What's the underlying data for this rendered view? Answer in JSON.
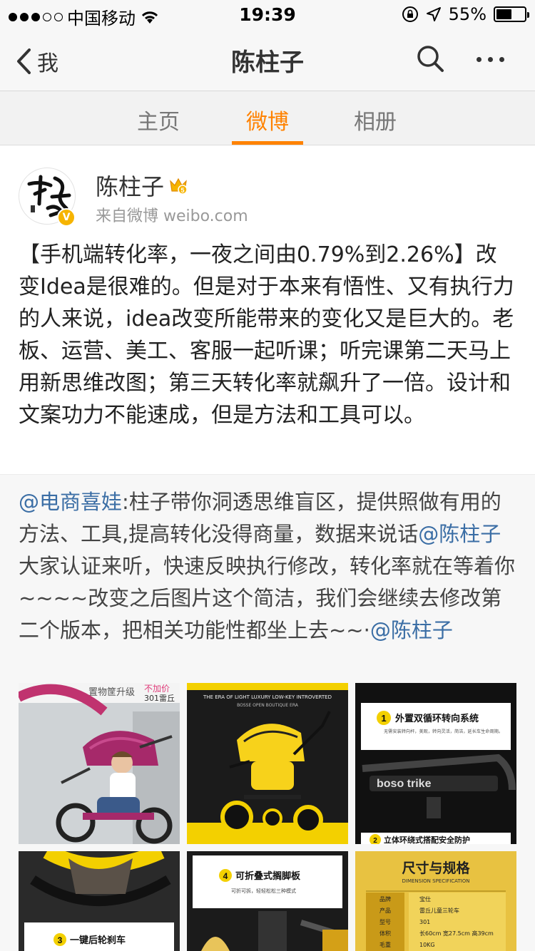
{
  "status_bar": {
    "carrier": "中国移动",
    "time": "19:39",
    "battery": "55%",
    "battery_level": 0.55
  },
  "nav": {
    "back_label": "我",
    "title": "陈柱子"
  },
  "tabs": [
    {
      "label": "主页"
    },
    {
      "label": "微博"
    },
    {
      "label": "相册"
    }
  ],
  "post": {
    "user_name": "陈柱子",
    "source": "来自微博 weibo.com",
    "content": "【手机端转化率，一夜之间由0.79%到2.26%】改变Idea是很难的。但是对于本来有悟性、又有执行力的人来说，idea改变所能带来的变化又是巨大的。老板、运营、美工、客服一起听课；听完课第二天马上用新思维改图；第三天转化率就飙升了一倍。设计和文案功力不能速成，但是方法和工具可以。"
  },
  "retweet": {
    "mention1": "@电商喜娃",
    "text1": ":柱子带你洞透思维盲区，提供照做有用的方法、工具,提高转化没得商量，数据来说话",
    "mention2": "@陈柱子",
    "text2": " 大家认证来听，快速反映执行修改，转化率就在等着你~~~~改变之后图片这个简洁，我们会继续去修改第二个版本，把相关功能性都坐上去~~·",
    "mention3": "@陈柱子"
  },
  "images": {
    "img1": {
      "top_label": "置物筐升级",
      "tag": "不加价",
      "sub": "301雷丘"
    },
    "img2": {
      "top_label": "THE ERA OF LIGHT LUXURY LOW-KEY INTROVERTED",
      "sub": "BOSSE OPEN BOUTIQUE ERA"
    },
    "img3": {
      "num": "1",
      "title": "外置双循环转向系统",
      "desc": "无需安装转向杆，美观，转向灵活，简洁，延长车生命周期。",
      "brand": "boso trike",
      "num2": "2",
      "title2": "立体环绕式搭配安全防护"
    },
    "img4": {
      "num": "3",
      "title": "一键后轮刹车"
    },
    "img5": {
      "num": "4",
      "title": "可折叠式搁脚板",
      "desc": "可折可拆，轻轻松松三种模式"
    },
    "img6": {
      "title": "尺寸与规格",
      "subtitle": "DIMENSION SPECIFICATION",
      "rows": [
        {
          "k": "品牌",
          "v": "宝仕"
        },
        {
          "k": "产品",
          "v": "雷丘儿童三轮车"
        },
        {
          "k": "型号",
          "v": "301"
        },
        {
          "k": "体积",
          "v": "长60cm 宽27.5cm 高39cm"
        },
        {
          "k": "毛重",
          "v": "10KG"
        }
      ]
    }
  },
  "colors": {
    "accent": "#ff8200",
    "mention": "#3b6ea5",
    "verified": "#f6b400"
  }
}
